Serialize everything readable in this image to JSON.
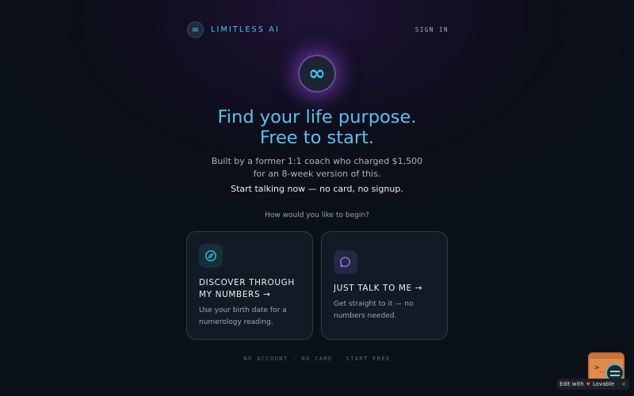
{
  "header": {
    "brand_icon": "infinity-icon",
    "brand_name": "LIMITLESS AI",
    "sign_in": "SIGN IN"
  },
  "hero": {
    "icon": "infinity-icon",
    "title_line1": "Find your life purpose.",
    "title_line2": "Free to start.",
    "subtitle": "Built by a former 1:1 coach who charged $1,500 for an 8-week version of this.",
    "cta_note": "Start talking now — no card, no signup."
  },
  "choose": {
    "prompt": "How would you like to begin?",
    "cards": [
      {
        "icon": "compass-icon",
        "title": "DISCOVER THROUGH MY NUMBERS →",
        "description": "Use your birth date for a numerology reading."
      },
      {
        "icon": "chat-bubble-icon",
        "title": "JUST TALK TO ME →",
        "description": "Get straight to it — no numbers needed."
      }
    ]
  },
  "footer": {
    "note": "NO ACCOUNT · NO CARD · START FREE"
  },
  "lovable": {
    "badge_prefix": "Edit with",
    "badge_brand": "Lovable",
    "badge_close": "×"
  },
  "colors": {
    "accent": "#57c3ec",
    "compass": "#2fc6e0",
    "chat": "#8a7cf0",
    "glow": "#8246c8"
  }
}
